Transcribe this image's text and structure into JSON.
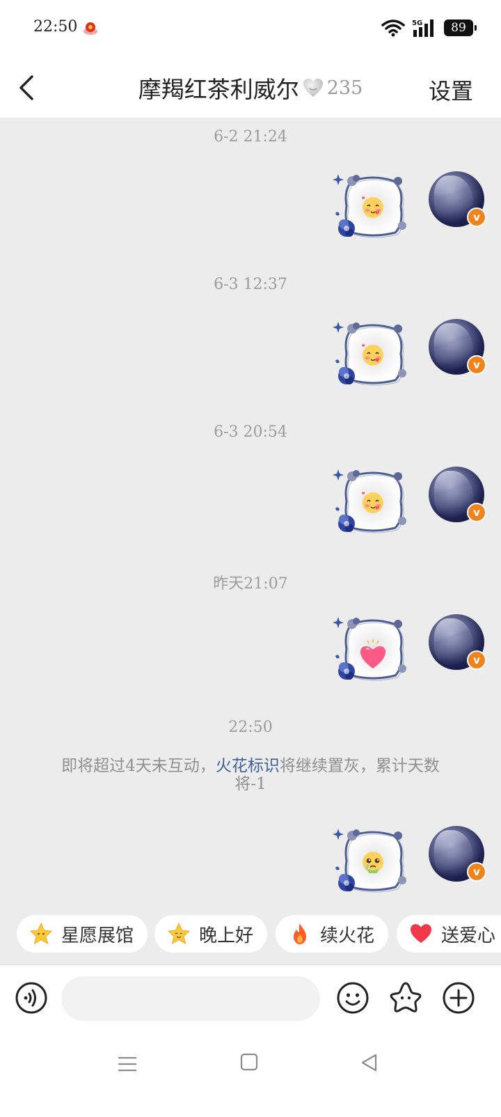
{
  "status_bar": {
    "time": "22:50",
    "network": "5G",
    "battery": "89"
  },
  "header": {
    "title": "摩羯红茶利威尔",
    "heart_count": "235",
    "settings_label": "设置"
  },
  "messages": [
    {
      "timestamp": "6-2 21:24",
      "sticker": "blush-kiss-emoji-sticker"
    },
    {
      "timestamp": "6-3 12:37",
      "sticker": "blush-kiss-emoji-sticker"
    },
    {
      "timestamp": "6-3 20:54",
      "sticker": "blush-kiss-emoji-sticker"
    },
    {
      "timestamp": "昨天21:07",
      "sticker": "heart-sticker"
    },
    {
      "timestamp": "22:50",
      "sticker": "pleading-emoji-sticker"
    }
  ],
  "system_note": {
    "before": "即将超过4天未互动，",
    "link": "火花标识",
    "after": "将继续置灰，累计天数将-1"
  },
  "quick_replies": [
    {
      "label": "星愿展馆",
      "icon": "star-icon"
    },
    {
      "label": "晚上好",
      "icon": "smiling-star-icon"
    },
    {
      "label": "续火花",
      "icon": "fire-icon"
    },
    {
      "label": "送爱心",
      "icon": "heart-icon"
    }
  ],
  "input": {
    "placeholder": ""
  },
  "colors": {
    "chat_background": "#ececec",
    "link": "#3f5f96",
    "badge": "#f0841c"
  }
}
